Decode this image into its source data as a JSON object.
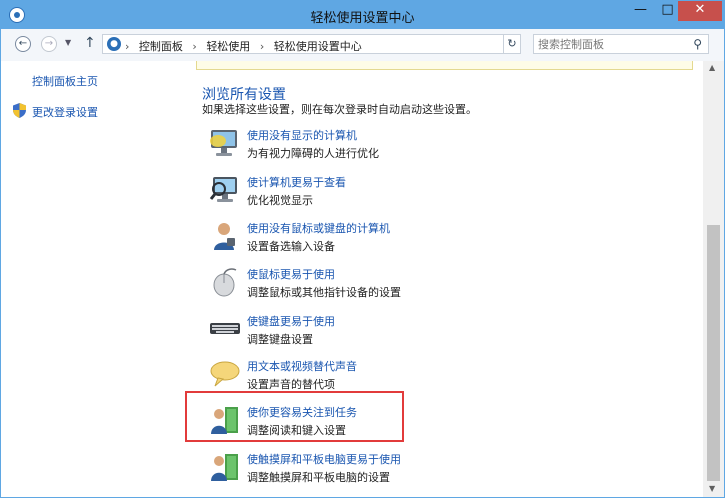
{
  "window": {
    "title": "轻松使用设置中心",
    "minimize": "—",
    "maximize": "□",
    "close": "✕"
  },
  "nav": {
    "back": "←",
    "forward": "→",
    "recent": "▼",
    "up": "↑"
  },
  "address": {
    "crumbs": [
      "控制面板",
      "轻松使用",
      "轻松使用设置中心"
    ],
    "separator": "›",
    "dropdown": "▼",
    "refresh": "↻"
  },
  "search": {
    "placeholder": "搜索控制面板",
    "icon": "⚲"
  },
  "sidebar": {
    "home": "控制面板主页",
    "change_login": "更改登录设置"
  },
  "main": {
    "section_title": "浏览所有设置",
    "section_desc": "如果选择这些设置，则在每次登录时自动启动这些设置。",
    "items": [
      {
        "icon": "monitor-icon",
        "link": "使用没有显示的计算机",
        "desc": "为有视力障碍的人进行优化"
      },
      {
        "icon": "magnifier-display-icon",
        "link": "使计算机更易于查看",
        "desc": "优化视觉显示"
      },
      {
        "icon": "user-icon",
        "link": "使用没有鼠标或键盘的计算机",
        "desc": "设置备选输入设备"
      },
      {
        "icon": "mouse-icon",
        "link": "使鼠标更易于使用",
        "desc": "调整鼠标或其他指针设备的设置"
      },
      {
        "icon": "keyboard-icon",
        "link": "使键盘更易于使用",
        "desc": "调整键盘设置"
      },
      {
        "icon": "speech-bubble-icon",
        "link": "用文本或视频替代声音",
        "desc": "设置声音的替代项"
      },
      {
        "icon": "person-door-icon",
        "link": "使你更容易关注到任务",
        "desc": "调整阅读和键入设置"
      },
      {
        "icon": "person-touch-icon",
        "link": "使触摸屏和平板电脑更易于使用",
        "desc": "调整触摸屏和平板电脑的设置"
      }
    ]
  },
  "scrollbar": {
    "up": "▲",
    "down": "▼"
  },
  "colors": {
    "link": "#1a56b0",
    "titlebar": "#5fa7e3",
    "close_button": "#c7504c",
    "highlight_box": "#e23b3b"
  }
}
